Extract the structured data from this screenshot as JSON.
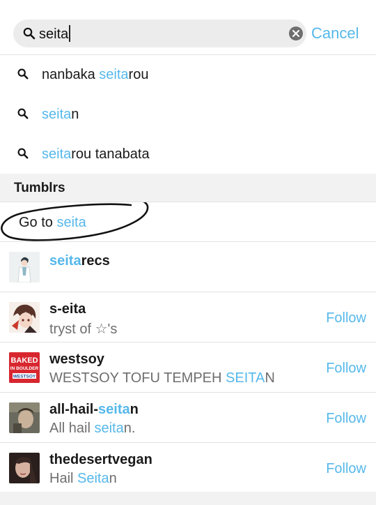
{
  "search": {
    "query": "seita",
    "cancel_label": "Cancel"
  },
  "suggestions": [
    {
      "pre": "nanbaka ",
      "match": "seita",
      "post": "rou"
    },
    {
      "pre": "",
      "match": "seita",
      "post": "n"
    },
    {
      "pre": "",
      "match": "seita",
      "post": "rou tanabata"
    }
  ],
  "section_title": "Tumblrs",
  "goto": {
    "prefix": "Go to ",
    "query": "seita"
  },
  "blogs": [
    {
      "name_pre": "",
      "name_match": "seita",
      "name_post": "recs",
      "desc_pre": "",
      "desc_match": "",
      "desc_post": "",
      "follow": ""
    },
    {
      "name_pre": "s-eita",
      "name_match": "",
      "name_post": "",
      "desc_pre": "tryst of ☆'s",
      "desc_match": "",
      "desc_post": "",
      "follow": "Follow"
    },
    {
      "name_pre": "westsoy",
      "name_match": "",
      "name_post": "",
      "desc_pre": "WESTSOY TOFU TEMPEH ",
      "desc_match": "SEITA",
      "desc_post": "N",
      "follow": "Follow"
    },
    {
      "name_pre": "all-hail-",
      "name_match": "seita",
      "name_post": "n",
      "desc_pre": "All hail ",
      "desc_match": "seita",
      "desc_post": "n.",
      "follow": "Follow"
    },
    {
      "name_pre": "thedesertvegan",
      "name_match": "",
      "name_post": "",
      "desc_pre": "Hail ",
      "desc_match": "Seita",
      "desc_post": "n",
      "follow": "Follow"
    }
  ],
  "westsoy_logo": {
    "line1": "BAKED",
    "line2": "IN BOULDER",
    "line3": "WESTSOY"
  },
  "colors": {
    "accent": "#56b8ea",
    "text": "#1a1a1a",
    "muted": "#6e6e6e"
  }
}
